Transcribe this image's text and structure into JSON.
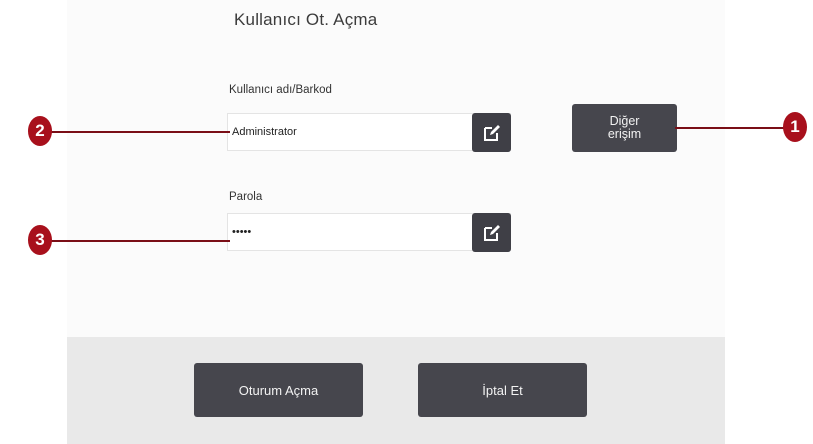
{
  "title": "Kullanıcı Ot. Açma",
  "username": {
    "label": "Kullanıcı adı/Barkod",
    "value": "Administrator"
  },
  "password": {
    "label": "Parola",
    "value": "•••••"
  },
  "other_access": {
    "line1": "Diğer",
    "line2": "erişim"
  },
  "footer": {
    "login_label": "Oturum Açma",
    "cancel_label": "İptal Et"
  },
  "callouts": {
    "c1": "1",
    "c2": "2",
    "c3": "3"
  },
  "icons": {
    "edit": "edit-pencil-icon"
  },
  "colors": {
    "button_dark": "#46464d",
    "callout_red": "#a8101c",
    "footer_bg": "#e9e9e9"
  }
}
